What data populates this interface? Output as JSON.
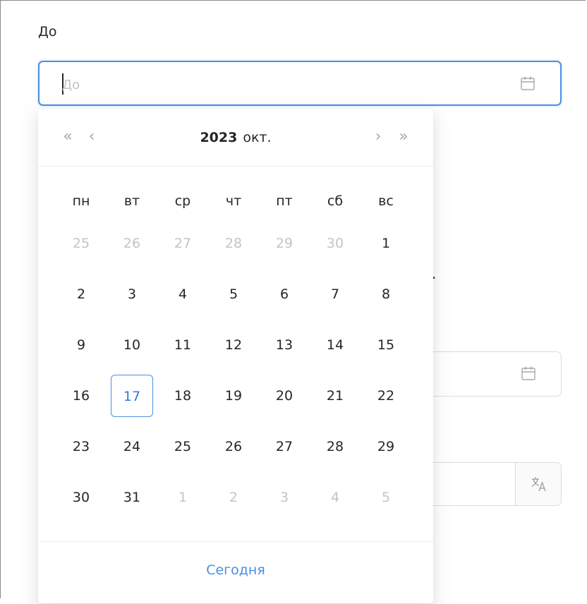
{
  "field": {
    "label": "До",
    "placeholder": "До",
    "value": "",
    "icon": "calendar-icon"
  },
  "picker": {
    "nav": {
      "super_prev": "«",
      "prev": "‹",
      "next": "›",
      "super_next": "»"
    },
    "year": "2023",
    "month": "окт.",
    "weekdays": [
      "пн",
      "вт",
      "ср",
      "чт",
      "пт",
      "сб",
      "вс"
    ],
    "weeks": [
      [
        {
          "d": "25",
          "out": true
        },
        {
          "d": "26",
          "out": true
        },
        {
          "d": "27",
          "out": true
        },
        {
          "d": "28",
          "out": true
        },
        {
          "d": "29",
          "out": true
        },
        {
          "d": "30",
          "out": true
        },
        {
          "d": "1",
          "out": false
        }
      ],
      [
        {
          "d": "2",
          "out": false
        },
        {
          "d": "3",
          "out": false
        },
        {
          "d": "4",
          "out": false
        },
        {
          "d": "5",
          "out": false
        },
        {
          "d": "6",
          "out": false
        },
        {
          "d": "7",
          "out": false
        },
        {
          "d": "8",
          "out": false
        }
      ],
      [
        {
          "d": "9",
          "out": false
        },
        {
          "d": "10",
          "out": false
        },
        {
          "d": "11",
          "out": false
        },
        {
          "d": "12",
          "out": false
        },
        {
          "d": "13",
          "out": false
        },
        {
          "d": "14",
          "out": false
        },
        {
          "d": "15",
          "out": false
        }
      ],
      [
        {
          "d": "16",
          "out": false
        },
        {
          "d": "17",
          "out": false,
          "today": true
        },
        {
          "d": "18",
          "out": false
        },
        {
          "d": "19",
          "out": false
        },
        {
          "d": "20",
          "out": false
        },
        {
          "d": "21",
          "out": false
        },
        {
          "d": "22",
          "out": false
        }
      ],
      [
        {
          "d": "23",
          "out": false
        },
        {
          "d": "24",
          "out": false
        },
        {
          "d": "25",
          "out": false
        },
        {
          "d": "26",
          "out": false
        },
        {
          "d": "27",
          "out": false
        },
        {
          "d": "28",
          "out": false
        },
        {
          "d": "29",
          "out": false
        }
      ],
      [
        {
          "d": "30",
          "out": false
        },
        {
          "d": "31",
          "out": false
        },
        {
          "d": "1",
          "out": true
        },
        {
          "d": "2",
          "out": true
        },
        {
          "d": "3",
          "out": true
        },
        {
          "d": "4",
          "out": true
        },
        {
          "d": "5",
          "out": true
        }
      ]
    ],
    "today_label": "Сегодня"
  },
  "background": {
    "period_fragment": "."
  },
  "colors": {
    "accent": "#4a90e2",
    "muted_day": "#c4c4c4",
    "text": "#262626"
  }
}
